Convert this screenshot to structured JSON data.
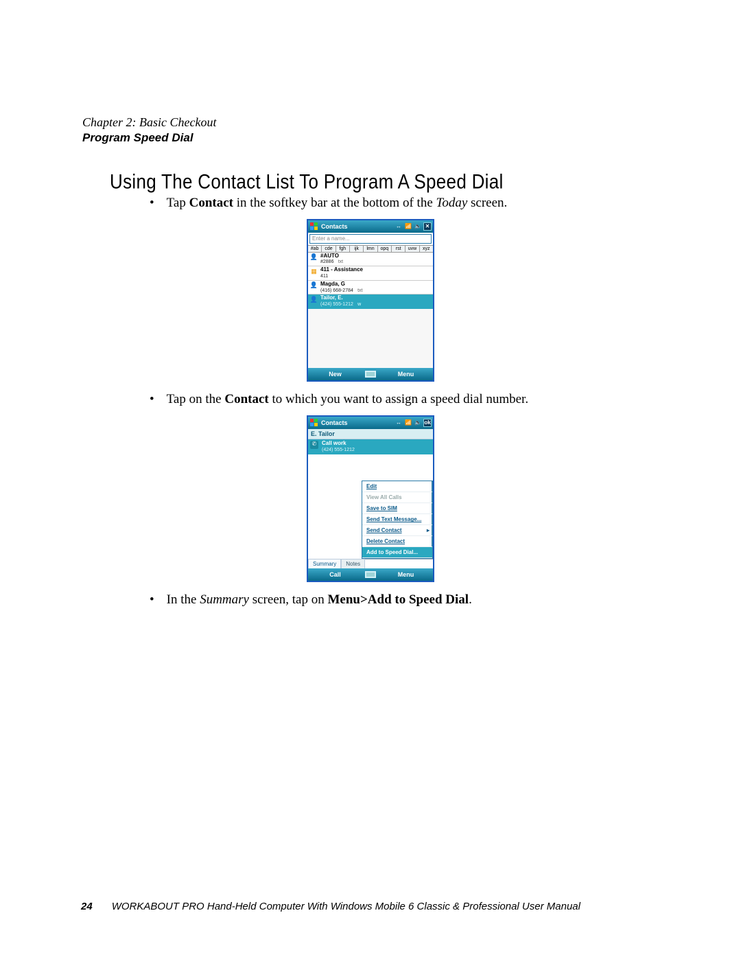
{
  "header": {
    "chapter": "Chapter 2: Basic Checkout",
    "section": "Program Speed Dial"
  },
  "heading": "Using The Contact List To Program A Speed Dial",
  "bullets": {
    "b1": {
      "pre": "Tap ",
      "bold": "Contact",
      "mid": " in the softkey bar at the bottom of the ",
      "ital": "Today",
      "post": " screen."
    },
    "b2": {
      "pre": "Tap on the ",
      "bold": "Contact",
      "post": " to which you want to assign a speed dial number."
    },
    "b3": {
      "pre": "In the ",
      "ital": "Summary",
      "mid": " screen, tap on ",
      "bold": "Menu>Add to Speed Dial",
      "post": "."
    }
  },
  "shot1": {
    "title": "Contacts",
    "close": "✕",
    "search_placeholder": "Enter a name...",
    "tabs": [
      "#ab",
      "cde",
      "fgh",
      "ijk",
      "lmn",
      "opq",
      "rst",
      "uvw",
      "xyz"
    ],
    "items": [
      {
        "line1": "#AUTO",
        "line2": "#2886",
        "suffix": "txt"
      },
      {
        "line1": "411 - Assistance",
        "line2": "411",
        "suffix": ""
      },
      {
        "line1": "Magda, G",
        "line2": "(416) 668-2784",
        "suffix": "txt"
      },
      {
        "line1": "Tailor, E.",
        "line2": "(424) 555-1212",
        "suffix": "w"
      }
    ],
    "soft_left": "New",
    "soft_right": "Menu"
  },
  "shot2": {
    "title": "Contacts",
    "ok": "ok",
    "contact_name": "E. Tailor",
    "item": {
      "line1": "Call work",
      "line2": "(424) 555-1212"
    },
    "menu": [
      {
        "label": "Edit",
        "state": "normal"
      },
      {
        "label": "View All Calls",
        "state": "disabled"
      },
      {
        "label": "Save to SIM",
        "state": "normal"
      },
      {
        "label": "Send Text Message...",
        "state": "normal"
      },
      {
        "label": "Send Contact",
        "state": "arrow"
      },
      {
        "label": "Delete Contact",
        "state": "normal"
      },
      {
        "label": "Add to Speed Dial...",
        "state": "hl"
      }
    ],
    "bottom_tabs": [
      "Summary",
      "Notes"
    ],
    "soft_left": "Call",
    "soft_right": "Menu"
  },
  "footer": {
    "page": "24",
    "text": "WORKABOUT PRO Hand-Held Computer With Windows Mobile 6 Classic & Professional User Manual"
  }
}
